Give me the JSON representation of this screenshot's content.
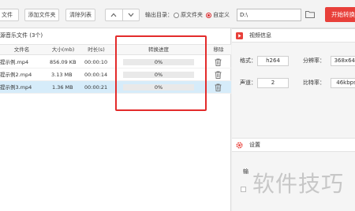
{
  "toolbar": {
    "add_file_label": "文件",
    "add_folder_label": "添加文件夹",
    "clear_list_label": "清除列表",
    "move_up_icon": "chevron-up",
    "move_down_icon": "chevron-down",
    "output_dir_label": "输出目录：",
    "option_original_label": "原文件夹",
    "option_custom_label": "自定义",
    "selected_option": "自定义",
    "path_value": "D:\\",
    "start_label": "开始转换",
    "accent_color": "#e8403a"
  },
  "file_list": {
    "title": "源音乐文件 (3个)",
    "columns": [
      "文件名",
      "大小(mb)",
      "时长(s)",
      "转换进度",
      "移除"
    ],
    "rows": [
      {
        "name": "提示例.mp4",
        "size": "856.09 KB",
        "duration": "00:00:10",
        "progress": "0%",
        "selected": false
      },
      {
        "name": "提示例2.mp4",
        "size": "3.13 MB",
        "duration": "00:00:14",
        "progress": "0%",
        "selected": false
      },
      {
        "name": "提示例3.mp4",
        "size": "1.36 MB",
        "duration": "00:00:21",
        "progress": "0%",
        "selected": true
      }
    ]
  },
  "video_info": {
    "title": "视频信息",
    "format_label": "格式：",
    "format_value": "h264",
    "resolution_label": "分辨率：",
    "resolution_value": "368x640",
    "channels_label": "声道：",
    "channels_value": "2",
    "bitrate_label": "比特率：",
    "bitrate_value": "46kbps"
  },
  "settings": {
    "title": "设置",
    "output_label": "输"
  },
  "watermark_text": "软件技巧",
  "highlight_color": "#e32b2b"
}
